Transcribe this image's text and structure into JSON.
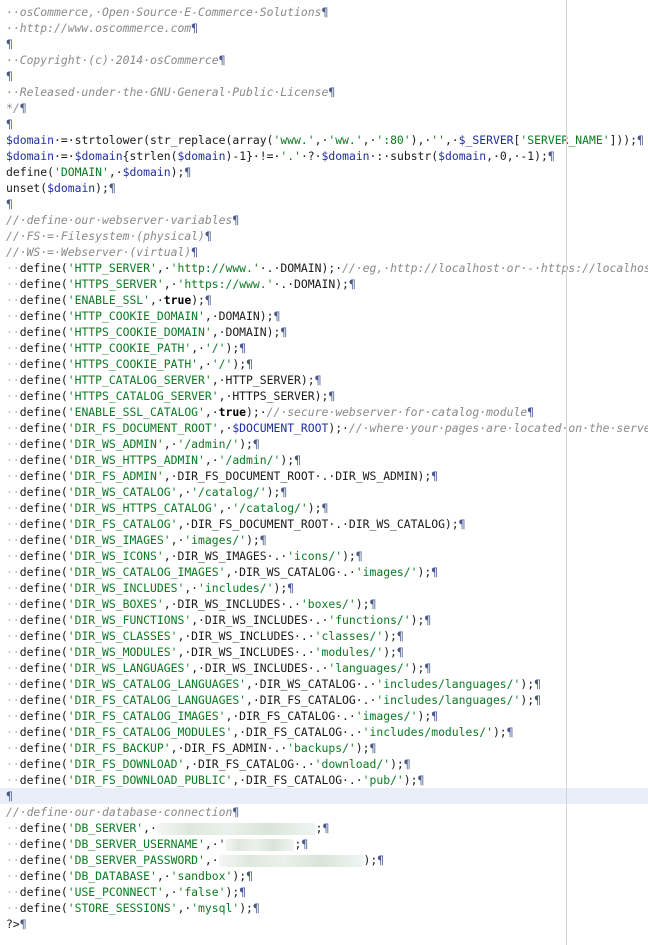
{
  "editor": {
    "pilcrow": "¶",
    "highlighted_line": 49,
    "lines": [
      [
        {
          "t": "c",
          "v": "··osCommerce,·Open·Source·E-Commerce·Solutions"
        }
      ],
      [
        {
          "t": "c",
          "v": "··http://www.oscommerce.com"
        }
      ],
      [],
      [
        {
          "t": "c",
          "v": "··Copyright·(c)·2014·osCommerce"
        }
      ],
      [],
      [
        {
          "t": "c",
          "v": "··Released·under·the·GNU·General·Public·License"
        }
      ],
      [
        {
          "t": "c",
          "v": "*/"
        }
      ],
      [],
      [
        {
          "t": "v",
          "v": "$domain"
        },
        {
          "t": "p",
          "v": "·=·strtolower(str_replace(array("
        },
        {
          "t": "s",
          "v": "'www.'"
        },
        {
          "t": "p",
          "v": ",·"
        },
        {
          "t": "s",
          "v": "'ww.'"
        },
        {
          "t": "p",
          "v": ",·"
        },
        {
          "t": "s",
          "v": "':80'"
        },
        {
          "t": "p",
          "v": "),·"
        },
        {
          "t": "s",
          "v": "''"
        },
        {
          "t": "p",
          "v": ",·"
        },
        {
          "t": "v",
          "v": "$_SERVER"
        },
        {
          "t": "p",
          "v": "["
        },
        {
          "t": "s",
          "v": "'SERVER_NAME'"
        },
        {
          "t": "p",
          "v": "]));"
        }
      ],
      [
        {
          "t": "v",
          "v": "$domain"
        },
        {
          "t": "p",
          "v": "·=·"
        },
        {
          "t": "v",
          "v": "$domain"
        },
        {
          "t": "p",
          "v": "{strlen("
        },
        {
          "t": "v",
          "v": "$domain"
        },
        {
          "t": "p",
          "v": ")-1}·!=·"
        },
        {
          "t": "s",
          "v": "'.'"
        },
        {
          "t": "p",
          "v": "·?·"
        },
        {
          "t": "v",
          "v": "$domain"
        },
        {
          "t": "p",
          "v": "·:·substr("
        },
        {
          "t": "v",
          "v": "$domain"
        },
        {
          "t": "p",
          "v": ",·0,·-1);"
        }
      ],
      [
        {
          "t": "p",
          "v": "define("
        },
        {
          "t": "s",
          "v": "'DOMAIN'"
        },
        {
          "t": "p",
          "v": ",·"
        },
        {
          "t": "v",
          "v": "$domain"
        },
        {
          "t": "p",
          "v": ");"
        }
      ],
      [
        {
          "t": "p",
          "v": "unset("
        },
        {
          "t": "v",
          "v": "$domain"
        },
        {
          "t": "p",
          "v": ");"
        }
      ],
      [],
      [
        {
          "t": "c",
          "v": "//·define·our·webserver·variables"
        }
      ],
      [
        {
          "t": "c",
          "v": "//·FS·=·Filesystem·(physical)"
        }
      ],
      [
        {
          "t": "c",
          "v": "//·WS·=·Webserver·(virtual)"
        }
      ],
      [
        {
          "t": "w",
          "v": "··"
        },
        {
          "t": "p",
          "v": "define("
        },
        {
          "t": "s",
          "v": "'HTTP_SERVER'"
        },
        {
          "t": "p",
          "v": ",·"
        },
        {
          "t": "s",
          "v": "'http://www.'"
        },
        {
          "t": "p",
          "v": "·.·DOMAIN);·"
        },
        {
          "t": "c",
          "v": "//·eg,·http://localhost·or·-·https://localhost"
        }
      ],
      [
        {
          "t": "w",
          "v": "··"
        },
        {
          "t": "p",
          "v": "define("
        },
        {
          "t": "s",
          "v": "'HTTPS_SERVER'"
        },
        {
          "t": "p",
          "v": ",·"
        },
        {
          "t": "s",
          "v": "'https://www.'"
        },
        {
          "t": "p",
          "v": "·.·DOMAIN);"
        }
      ],
      [
        {
          "t": "w",
          "v": "··"
        },
        {
          "t": "p",
          "v": "define("
        },
        {
          "t": "s",
          "v": "'ENABLE_SSL'"
        },
        {
          "t": "p",
          "v": ",·"
        },
        {
          "t": "k",
          "v": "true"
        },
        {
          "t": "p",
          "v": ");"
        }
      ],
      [
        {
          "t": "w",
          "v": "··"
        },
        {
          "t": "p",
          "v": "define("
        },
        {
          "t": "s",
          "v": "'HTTP_COOKIE_DOMAIN'"
        },
        {
          "t": "p",
          "v": ",·DOMAIN);"
        }
      ],
      [
        {
          "t": "w",
          "v": "··"
        },
        {
          "t": "p",
          "v": "define("
        },
        {
          "t": "s",
          "v": "'HTTPS_COOKIE_DOMAIN'"
        },
        {
          "t": "p",
          "v": ",·DOMAIN);"
        }
      ],
      [
        {
          "t": "w",
          "v": "··"
        },
        {
          "t": "p",
          "v": "define("
        },
        {
          "t": "s",
          "v": "'HTTP_COOKIE_PATH'"
        },
        {
          "t": "p",
          "v": ",·"
        },
        {
          "t": "s",
          "v": "'/'"
        },
        {
          "t": "p",
          "v": ");"
        }
      ],
      [
        {
          "t": "w",
          "v": "··"
        },
        {
          "t": "p",
          "v": "define("
        },
        {
          "t": "s",
          "v": "'HTTPS_COOKIE_PATH'"
        },
        {
          "t": "p",
          "v": ",·"
        },
        {
          "t": "s",
          "v": "'/'"
        },
        {
          "t": "p",
          "v": ");"
        }
      ],
      [
        {
          "t": "w",
          "v": "··"
        },
        {
          "t": "p",
          "v": "define("
        },
        {
          "t": "s",
          "v": "'HTTP_CATALOG_SERVER'"
        },
        {
          "t": "p",
          "v": ",·HTTP_SERVER);"
        }
      ],
      [
        {
          "t": "w",
          "v": "··"
        },
        {
          "t": "p",
          "v": "define("
        },
        {
          "t": "s",
          "v": "'HTTPS_CATALOG_SERVER'"
        },
        {
          "t": "p",
          "v": ",·HTTPS_SERVER);"
        }
      ],
      [
        {
          "t": "w",
          "v": "··"
        },
        {
          "t": "p",
          "v": "define("
        },
        {
          "t": "s",
          "v": "'ENABLE_SSL_CATALOG'"
        },
        {
          "t": "p",
          "v": ",·"
        },
        {
          "t": "k",
          "v": "true"
        },
        {
          "t": "p",
          "v": ");·"
        },
        {
          "t": "c",
          "v": "//·secure·webserver·for·catalog·module"
        }
      ],
      [
        {
          "t": "w",
          "v": "··"
        },
        {
          "t": "p",
          "v": "define("
        },
        {
          "t": "s",
          "v": "'DIR_FS_DOCUMENT_ROOT'"
        },
        {
          "t": "p",
          "v": ",·"
        },
        {
          "t": "v",
          "v": "$DOCUMENT_ROOT"
        },
        {
          "t": "p",
          "v": ");·"
        },
        {
          "t": "c",
          "v": "//·where·your·pages·are·located·on·the·server."
        }
      ],
      [
        {
          "t": "w",
          "v": "··"
        },
        {
          "t": "p",
          "v": "define("
        },
        {
          "t": "s",
          "v": "'DIR_WS_ADMIN'"
        },
        {
          "t": "p",
          "v": ",·"
        },
        {
          "t": "s",
          "v": "'/admin/'"
        },
        {
          "t": "p",
          "v": ");"
        }
      ],
      [
        {
          "t": "w",
          "v": "··"
        },
        {
          "t": "p",
          "v": "define("
        },
        {
          "t": "s",
          "v": "'DIR_WS_HTTPS_ADMIN'"
        },
        {
          "t": "p",
          "v": ",·"
        },
        {
          "t": "s",
          "v": "'/admin/'"
        },
        {
          "t": "p",
          "v": ");"
        }
      ],
      [
        {
          "t": "w",
          "v": "··"
        },
        {
          "t": "p",
          "v": "define("
        },
        {
          "t": "s",
          "v": "'DIR_FS_ADMIN'"
        },
        {
          "t": "p",
          "v": ",·DIR_FS_DOCUMENT_ROOT·.·DIR_WS_ADMIN);"
        }
      ],
      [
        {
          "t": "w",
          "v": "··"
        },
        {
          "t": "p",
          "v": "define("
        },
        {
          "t": "s",
          "v": "'DIR_WS_CATALOG'"
        },
        {
          "t": "p",
          "v": ",·"
        },
        {
          "t": "s",
          "v": "'/catalog/'"
        },
        {
          "t": "p",
          "v": ");"
        }
      ],
      [
        {
          "t": "w",
          "v": "··"
        },
        {
          "t": "p",
          "v": "define("
        },
        {
          "t": "s",
          "v": "'DIR_WS_HTTPS_CATALOG'"
        },
        {
          "t": "p",
          "v": ",·"
        },
        {
          "t": "s",
          "v": "'/catalog/'"
        },
        {
          "t": "p",
          "v": ");"
        }
      ],
      [
        {
          "t": "w",
          "v": "··"
        },
        {
          "t": "p",
          "v": "define("
        },
        {
          "t": "s",
          "v": "'DIR_FS_CATALOG'"
        },
        {
          "t": "p",
          "v": ",·DIR_FS_DOCUMENT_ROOT·.·DIR_WS_CATALOG);"
        }
      ],
      [
        {
          "t": "w",
          "v": "··"
        },
        {
          "t": "p",
          "v": "define("
        },
        {
          "t": "s",
          "v": "'DIR_WS_IMAGES'"
        },
        {
          "t": "p",
          "v": ",·"
        },
        {
          "t": "s",
          "v": "'images/'"
        },
        {
          "t": "p",
          "v": ");"
        }
      ],
      [
        {
          "t": "w",
          "v": "··"
        },
        {
          "t": "p",
          "v": "define("
        },
        {
          "t": "s",
          "v": "'DIR_WS_ICONS'"
        },
        {
          "t": "p",
          "v": ",·DIR_WS_IMAGES·.·"
        },
        {
          "t": "s",
          "v": "'icons/'"
        },
        {
          "t": "p",
          "v": ");"
        }
      ],
      [
        {
          "t": "w",
          "v": "··"
        },
        {
          "t": "p",
          "v": "define("
        },
        {
          "t": "s",
          "v": "'DIR_WS_CATALOG_IMAGES'"
        },
        {
          "t": "p",
          "v": ",·DIR_WS_CATALOG·.·"
        },
        {
          "t": "s",
          "v": "'images/'"
        },
        {
          "t": "p",
          "v": ");"
        }
      ],
      [
        {
          "t": "w",
          "v": "··"
        },
        {
          "t": "p",
          "v": "define("
        },
        {
          "t": "s",
          "v": "'DIR_WS_INCLUDES'"
        },
        {
          "t": "p",
          "v": ",·"
        },
        {
          "t": "s",
          "v": "'includes/'"
        },
        {
          "t": "p",
          "v": ");"
        }
      ],
      [
        {
          "t": "w",
          "v": "··"
        },
        {
          "t": "p",
          "v": "define("
        },
        {
          "t": "s",
          "v": "'DIR_WS_BOXES'"
        },
        {
          "t": "p",
          "v": ",·DIR_WS_INCLUDES·.·"
        },
        {
          "t": "s",
          "v": "'boxes/'"
        },
        {
          "t": "p",
          "v": ");"
        }
      ],
      [
        {
          "t": "w",
          "v": "··"
        },
        {
          "t": "p",
          "v": "define("
        },
        {
          "t": "s",
          "v": "'DIR_WS_FUNCTIONS'"
        },
        {
          "t": "p",
          "v": ",·DIR_WS_INCLUDES·.·"
        },
        {
          "t": "s",
          "v": "'functions/'"
        },
        {
          "t": "p",
          "v": ");"
        }
      ],
      [
        {
          "t": "w",
          "v": "··"
        },
        {
          "t": "p",
          "v": "define("
        },
        {
          "t": "s",
          "v": "'DIR_WS_CLASSES'"
        },
        {
          "t": "p",
          "v": ",·DIR_WS_INCLUDES·.·"
        },
        {
          "t": "s",
          "v": "'classes/'"
        },
        {
          "t": "p",
          "v": ");"
        }
      ],
      [
        {
          "t": "w",
          "v": "··"
        },
        {
          "t": "p",
          "v": "define("
        },
        {
          "t": "s",
          "v": "'DIR_WS_MODULES'"
        },
        {
          "t": "p",
          "v": ",·DIR_WS_INCLUDES·.·"
        },
        {
          "t": "s",
          "v": "'modules/'"
        },
        {
          "t": "p",
          "v": ");"
        }
      ],
      [
        {
          "t": "w",
          "v": "··"
        },
        {
          "t": "p",
          "v": "define("
        },
        {
          "t": "s",
          "v": "'DIR_WS_LANGUAGES'"
        },
        {
          "t": "p",
          "v": ",·DIR_WS_INCLUDES·.·"
        },
        {
          "t": "s",
          "v": "'languages/'"
        },
        {
          "t": "p",
          "v": ");"
        }
      ],
      [
        {
          "t": "w",
          "v": "··"
        },
        {
          "t": "p",
          "v": "define("
        },
        {
          "t": "s",
          "v": "'DIR_WS_CATALOG_LANGUAGES'"
        },
        {
          "t": "p",
          "v": ",·DIR_WS_CATALOG·.·"
        },
        {
          "t": "s",
          "v": "'includes/languages/'"
        },
        {
          "t": "p",
          "v": ");"
        }
      ],
      [
        {
          "t": "w",
          "v": "··"
        },
        {
          "t": "p",
          "v": "define("
        },
        {
          "t": "s",
          "v": "'DIR_FS_CATALOG_LANGUAGES'"
        },
        {
          "t": "p",
          "v": ",·DIR_FS_CATALOG·.·"
        },
        {
          "t": "s",
          "v": "'includes/languages/'"
        },
        {
          "t": "p",
          "v": ");"
        }
      ],
      [
        {
          "t": "w",
          "v": "··"
        },
        {
          "t": "p",
          "v": "define("
        },
        {
          "t": "s",
          "v": "'DIR_FS_CATALOG_IMAGES'"
        },
        {
          "t": "p",
          "v": ",·DIR_FS_CATALOG·.·"
        },
        {
          "t": "s",
          "v": "'images/'"
        },
        {
          "t": "p",
          "v": ");"
        }
      ],
      [
        {
          "t": "w",
          "v": "··"
        },
        {
          "t": "p",
          "v": "define("
        },
        {
          "t": "s",
          "v": "'DIR_FS_CATALOG_MODULES'"
        },
        {
          "t": "p",
          "v": ",·DIR_FS_CATALOG·.·"
        },
        {
          "t": "s",
          "v": "'includes/modules/'"
        },
        {
          "t": "p",
          "v": ");"
        }
      ],
      [
        {
          "t": "w",
          "v": "··"
        },
        {
          "t": "p",
          "v": "define("
        },
        {
          "t": "s",
          "v": "'DIR_FS_BACKUP'"
        },
        {
          "t": "p",
          "v": ",·DIR_FS_ADMIN·.·"
        },
        {
          "t": "s",
          "v": "'backups/'"
        },
        {
          "t": "p",
          "v": ");"
        }
      ],
      [
        {
          "t": "w",
          "v": "··"
        },
        {
          "t": "p",
          "v": "define("
        },
        {
          "t": "s",
          "v": "'DIR_FS_DOWNLOAD'"
        },
        {
          "t": "p",
          "v": ",·DIR_FS_CATALOG·.·"
        },
        {
          "t": "s",
          "v": "'download/'"
        },
        {
          "t": "p",
          "v": ");"
        }
      ],
      [
        {
          "t": "w",
          "v": "··"
        },
        {
          "t": "p",
          "v": "define("
        },
        {
          "t": "s",
          "v": "'DIR_FS_DOWNLOAD_PUBLIC'"
        },
        {
          "t": "p",
          "v": ",·DIR_FS_CATALOG·.·"
        },
        {
          "t": "s",
          "v": "'pub/'"
        },
        {
          "t": "p",
          "v": ");"
        }
      ],
      [],
      [
        {
          "t": "c",
          "v": "//·define·our·database·connection"
        }
      ],
      [
        {
          "t": "w",
          "v": "··"
        },
        {
          "t": "p",
          "v": "define("
        },
        {
          "t": "s",
          "v": "'DB_SERVER'"
        },
        {
          "t": "p",
          "v": ",·"
        },
        {
          "t": "b",
          "v": "23"
        },
        {
          "t": "p",
          "v": ";"
        }
      ],
      [
        {
          "t": "w",
          "v": "··"
        },
        {
          "t": "p",
          "v": "define("
        },
        {
          "t": "s",
          "v": "'DB_SERVER_USERNAME'"
        },
        {
          "t": "p",
          "v": ",·'"
        },
        {
          "t": "b",
          "v": "10"
        },
        {
          "t": "p",
          "v": ";"
        }
      ],
      [
        {
          "t": "w",
          "v": "··"
        },
        {
          "t": "p",
          "v": "define("
        },
        {
          "t": "s",
          "v": "'DB_SERVER_PASSWORD'"
        },
        {
          "t": "p",
          "v": ",·"
        },
        {
          "t": "b",
          "v": "21"
        },
        {
          "t": "p",
          "v": ");"
        }
      ],
      [
        {
          "t": "w",
          "v": "··"
        },
        {
          "t": "p",
          "v": "define("
        },
        {
          "t": "s",
          "v": "'DB_DATABASE'"
        },
        {
          "t": "p",
          "v": ",·"
        },
        {
          "t": "s",
          "v": "'sandbox'"
        },
        {
          "t": "p",
          "v": ");"
        }
      ],
      [
        {
          "t": "w",
          "v": "··"
        },
        {
          "t": "p",
          "v": "define("
        },
        {
          "t": "s",
          "v": "'USE_PCONNECT'"
        },
        {
          "t": "p",
          "v": ",·"
        },
        {
          "t": "s",
          "v": "'false'"
        },
        {
          "t": "p",
          "v": ");"
        }
      ],
      [
        {
          "t": "w",
          "v": "··"
        },
        {
          "t": "p",
          "v": "define("
        },
        {
          "t": "s",
          "v": "'STORE_SESSIONS'"
        },
        {
          "t": "p",
          "v": ",·"
        },
        {
          "t": "s",
          "v": "'mysql'"
        },
        {
          "t": "p",
          "v": ");"
        }
      ],
      [
        {
          "t": "p",
          "v": "?>"
        }
      ]
    ]
  }
}
